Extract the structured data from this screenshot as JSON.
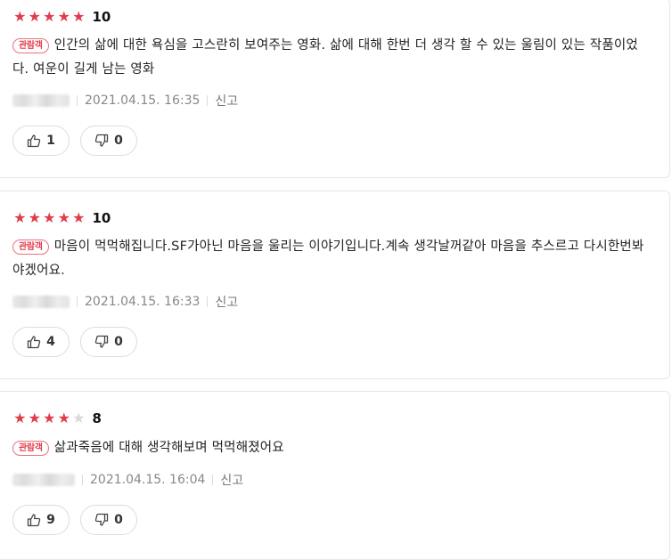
{
  "reviews": [
    {
      "stars_filled": 5,
      "stars_total": 5,
      "score": "10",
      "badge": "관람객",
      "text": "인간의 삶에 대한 욕심을 고스란히 보여주는 영화. 삶에 대해 한번 더 생각 할 수 있는 울림이 있는 작품이었다. 여운이 길게 남는 영화",
      "datetime": "2021.04.15. 16:35",
      "report_label": "신고",
      "likes": "1",
      "dislikes": "0"
    },
    {
      "stars_filled": 5,
      "stars_total": 5,
      "score": "10",
      "badge": "관람객",
      "text": "마음이 먹먹해집니다.SF가아닌 마음을 울리는 이야기입니다.계속 생각날꺼같아 마음을 추스르고 다시한번봐야겠어요.",
      "datetime": "2021.04.15. 16:33",
      "report_label": "신고",
      "likes": "4",
      "dislikes": "0"
    },
    {
      "stars_filled": 4,
      "stars_total": 5,
      "score": "8",
      "badge": "관람객",
      "text": "삶과죽음에 대해 생각해보며 먹먹해졌어요",
      "datetime": "2021.04.15. 16:04",
      "report_label": "신고",
      "likes": "9",
      "dislikes": "0"
    }
  ],
  "colors": {
    "star_on": "#e03c4a",
    "star_off": "#d9d9d9",
    "badge": "#e03c4a"
  },
  "icons": {
    "like": "thumbs-up-icon",
    "dislike": "thumbs-down-icon"
  }
}
